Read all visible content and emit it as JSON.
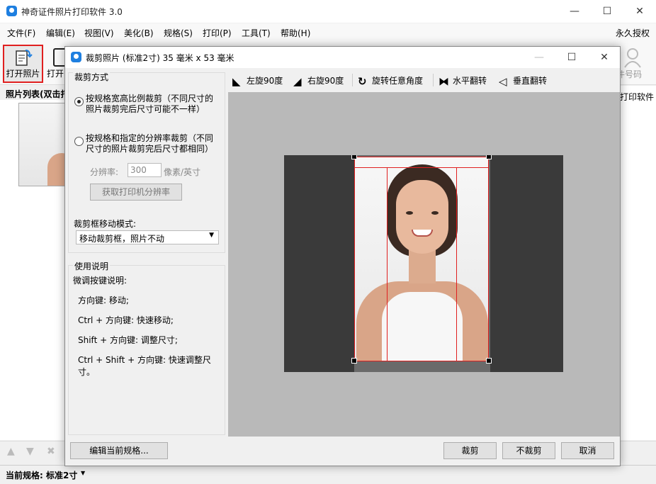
{
  "window": {
    "title": "神奇证件照片打印软件 3.0",
    "minimize": "—",
    "maximize": "☐",
    "close": "✕"
  },
  "menu": [
    "文件(F)",
    "编辑(E)",
    "视图(V)",
    "美化(B)",
    "规格(S)",
    "打印(P)",
    "工具(T)",
    "帮助(H)"
  ],
  "license": "永久授权",
  "toolbar": {
    "open_photo": "打开照片",
    "open2": "打开",
    "id_number": "件号码"
  },
  "photo_list": {
    "header": "照片列表(双击打"
  },
  "right_label": "打印软件",
  "status": {
    "current_spec_label": "当前规格: 标准2寸"
  },
  "dialog": {
    "title": "裁剪照片 (标准2寸) 35 毫米 x 53 毫米",
    "crop_mode_title": "裁剪方式",
    "option1_line1": "按规格宽高比例裁剪（不同尺寸的",
    "option1_line2": "照片裁剪完后尺寸可能不一样）",
    "option2_line1": "按规格和指定的分辨率裁剪（不同",
    "option2_line2": "尺寸的照片裁剪完后尺寸都相同）",
    "dpi_label": "分辨率:",
    "dpi_value": "300",
    "dpi_unit": "像素/英寸",
    "get_dpi_button": "获取打印机分辨率",
    "move_mode_label": "裁剪框移动模式:",
    "move_mode_value": "移动裁剪框，照片不动",
    "help_title": "使用说明",
    "help_lines": [
      "微调按键说明:",
      "方向键: 移动;",
      "Ctrl + 方向键: 快速移动;",
      "Shift + 方向键: 调整尺寸;",
      "Ctrl + Shift + 方向键: 快速调整尺寸。"
    ],
    "tools": {
      "rotate_left": "左旋90度",
      "rotate_right": "右旋90度",
      "rotate_any": "旋转任意角度",
      "flip_h": "水平翻转",
      "flip_v": "垂直翻转"
    },
    "edit_spec_button": "编辑当前规格...",
    "crop_button": "裁剪",
    "no_crop_button": "不裁剪",
    "cancel_button": "取消"
  }
}
